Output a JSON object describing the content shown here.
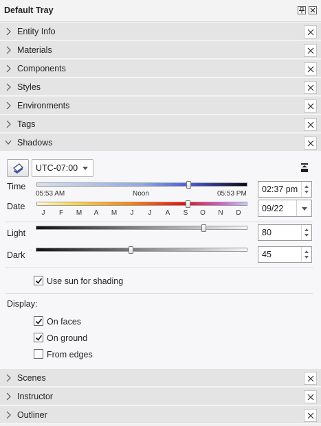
{
  "tray": {
    "title": "Default Tray"
  },
  "panels_top": [
    {
      "label": "Entity Info"
    },
    {
      "label": "Materials"
    },
    {
      "label": "Components"
    },
    {
      "label": "Styles"
    },
    {
      "label": "Environments"
    },
    {
      "label": "Tags"
    }
  ],
  "shadows": {
    "label": "Shadows",
    "timezone": "UTC-07:00",
    "time_label": "Time",
    "date_label": "Date",
    "sunrise": "05:53 AM",
    "noon": "Noon",
    "sunset": "05:53 PM",
    "months": [
      "J",
      "F",
      "M",
      "A",
      "M",
      "J",
      "J",
      "A",
      "S",
      "O",
      "N",
      "D"
    ],
    "time_value": "02:37 pm",
    "date_value": "09/22",
    "light_label": "Light",
    "light_value": "80",
    "dark_label": "Dark",
    "dark_value": "45",
    "use_sun_label": "Use sun for shading",
    "use_sun_checked": true,
    "display_label": "Display:",
    "on_faces_label": "On faces",
    "on_faces_checked": true,
    "on_ground_label": "On ground",
    "on_ground_checked": true,
    "from_edges_label": "From edges",
    "from_edges_checked": false
  },
  "panels_bottom": [
    {
      "label": "Scenes"
    },
    {
      "label": "Instructor"
    },
    {
      "label": "Outliner"
    }
  ]
}
